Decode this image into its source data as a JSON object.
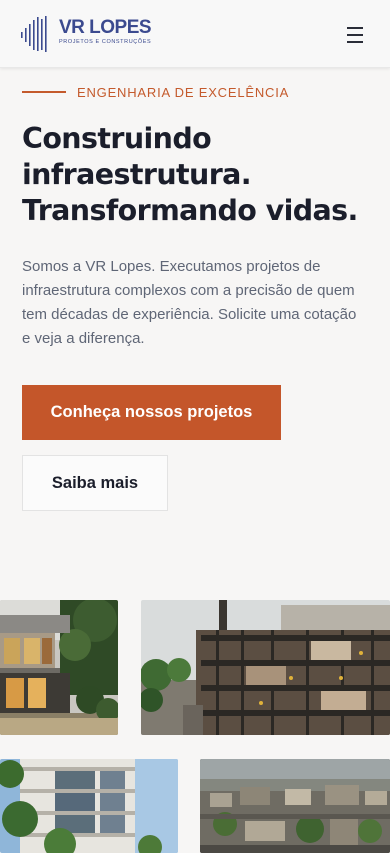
{
  "header": {
    "logo": {
      "title": "VR LOPES",
      "subtitle": "PROJETOS E CONSTRUÇÕES"
    },
    "menu_icon": "hamburger-menu-icon"
  },
  "hero": {
    "eyebrow": "ENGENHARIA DE EXCELÊNCIA",
    "title_lines": [
      "Construindo",
      "infraestrutura.",
      "Transformando vidas."
    ],
    "description_lines": [
      "Somos a VR Lopes. Executamos projetos de",
      "infraestrutura complexos com a precisão de quem",
      "tem décadas de experiência. Solicite uma cotação",
      "e veja a diferença."
    ],
    "primary_button": "Conheça nossos projetos",
    "secondary_button": "Saiba mais"
  },
  "colors": {
    "accent": "#c4562a",
    "brand": "#3b4a8f",
    "heading": "#1b1e2b",
    "body_text": "#5f6676",
    "background": "#f7f6f5"
  }
}
